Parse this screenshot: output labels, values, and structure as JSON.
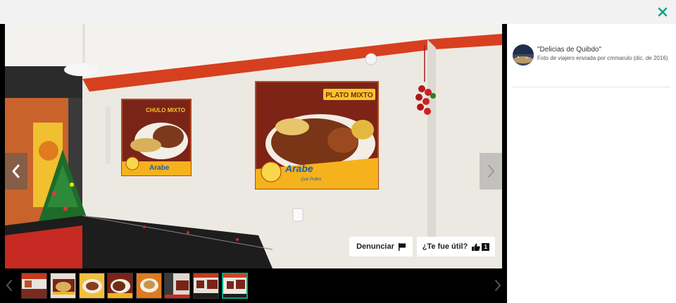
{
  "header": {
    "close_icon": "close-icon",
    "accent": "#00a680"
  },
  "photo": {
    "description_text": "",
    "left_sign": {
      "top_label": "CHULO MIXTO",
      "brand": "Arabe"
    },
    "right_sign": {
      "top_label": "PLATO MIXTO",
      "brand": "Arabe",
      "slogan": "Qué Pollos"
    }
  },
  "actions": {
    "report_label": "Denunciar",
    "helpful_label": "¿Te fue útil?",
    "helpful_count": "1"
  },
  "side": {
    "title": "\"Delicias de Quibdo\"",
    "meta": "Foto de viajero enviada por cmmarulo (dic. de 2016)"
  },
  "thumbnails": {
    "count": 8,
    "active_index": 7
  }
}
